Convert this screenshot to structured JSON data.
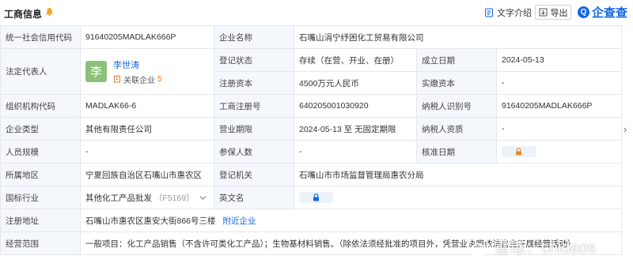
{
  "header": {
    "title": "工商信息",
    "text_intro_label": "文字介绍",
    "export_label": "导出",
    "logo_text": "企查查"
  },
  "rows": {
    "credit_code_label": "统一社会信用代码",
    "credit_code_value": "91640205MADLAK666P",
    "company_name_label": "企业名称",
    "company_name_value": "石嘴山涓宁纾困化工贸易有限公司",
    "legal_rep_label": "法定代表人",
    "legal_rep_avatar": "李",
    "legal_rep_name": "李世涛",
    "legal_rep_related_label": "关联企业",
    "legal_rep_related_count": "5",
    "reg_status_label": "登记状态",
    "reg_status_value": "存续（在营、开业、在册）",
    "founded_label": "成立日期",
    "founded_value": "2024-05-13",
    "reg_capital_label": "注册资本",
    "reg_capital_value": "4500万元人民币",
    "paid_capital_label": "实缴资本",
    "paid_capital_value": "-",
    "org_code_label": "组织机构代码",
    "org_code_value": "MADLAK66-6",
    "biz_reg_no_label": "工商注册号",
    "biz_reg_no_value": "640205001030920",
    "taxpayer_id_label": "纳税人识别号",
    "taxpayer_id_value": "91640205MADLAK666P",
    "company_type_label": "企业类型",
    "company_type_value": "其他有限责任公司",
    "biz_term_label": "营业期限",
    "biz_term_value": "2024-05-13 至 无固定期限",
    "taxpayer_qual_label": "纳税人资质",
    "taxpayer_qual_value": "-",
    "staff_size_label": "人员规模",
    "staff_size_value": "-",
    "insured_label": "参保人数",
    "insured_value": "-",
    "approval_date_label": "核准日期",
    "region_label": "所属地区",
    "region_value": "宁夏回族自治区石嘴山市惠农区",
    "reg_authority_label": "登记机关",
    "reg_authority_value": "石嘴山市市场监督管理局惠农分局",
    "industry_label": "国标行业",
    "industry_value": "其他化工产品批发",
    "industry_code": "（F5169）",
    "english_name_label": "英文名",
    "address_label": "注册地址",
    "address_value": "石嘴山市惠农区惠安大街866号三楼",
    "address_link": "附近企业",
    "scope_label": "经营范围",
    "scope_value": "一般项目：化工产品销售（不含许可类化工产品）；生物基材料销售。（除依法须经批准的项目外，凭营业执照依法自主开展经营活动）"
  },
  "watermark": {
    "text": "雪球：chidaos"
  },
  "colors": {
    "accent": "#1267e3",
    "label_bg": "#f4f7fb",
    "border": "#e4e7ec",
    "avatar_bg": "#8ec07a",
    "bell": "#f5a623",
    "lock": "#e58a2e"
  }
}
